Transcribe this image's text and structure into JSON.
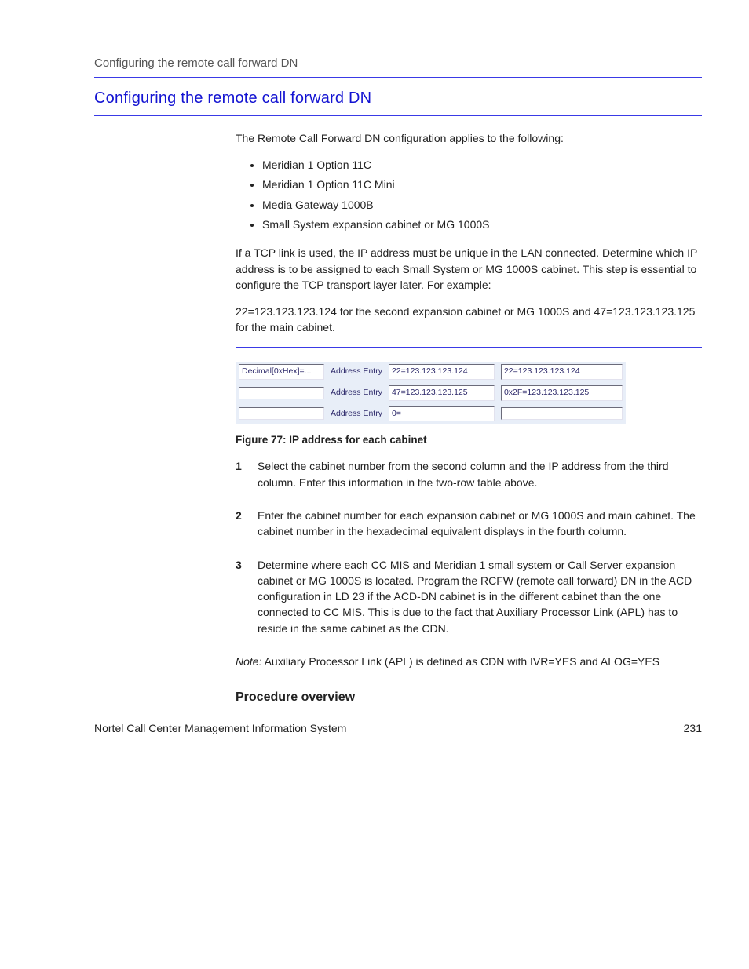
{
  "header": {
    "top_text": "Configuring the remote call forward DN"
  },
  "section": {
    "title": "Configuring the remote call forward DN"
  },
  "content": {
    "intro": "The Remote Call Forward DN configuration applies to the following:",
    "bullets": [
      "Meridian 1 Option 11C",
      "Meridian 1 Option 11C Mini",
      "Media Gateway 1000B",
      "Small System expansion cabinet or MG 1000S"
    ],
    "ip_intro": "If a TCP link is used, the IP address must be unique in the LAN connected. Determine which IP address is to be assigned to each Small System or MG 1000S cabinet. This step is essential to configure the TCP transport layer later. For example:",
    "ip_example": "22=123.123.123.124 for the second expansion cabinet or MG 1000S and 47=123.123.123.125 for the main cabinet.",
    "fig_table": {
      "rows": [
        {
          "c1": "Decimal[0xHex]=...",
          "c2": "Address Entry",
          "c3": "22=123.123.123.124",
          "c4": "22=123.123.123.124"
        },
        {
          "c1": "",
          "c2": "Address Entry",
          "c3": "47=123.123.123.125",
          "c4": "0x2F=123.123.123.125"
        },
        {
          "c1": "",
          "c2": "Address Entry",
          "c3": "0=",
          "c4": ""
        }
      ]
    },
    "fig_caption": "Figure 77: IP address for each cabinet",
    "steps": [
      "Select the cabinet number from the second column and the IP address from the third column. Enter this information in the two-row table above.",
      "Enter the cabinet number for each expansion cabinet or MG 1000S and main cabinet. The cabinet number in the hexadecimal equivalent displays in the fourth column.",
      "Determine where each CC MIS and Meridian 1 small system or Call Server expansion cabinet or MG 1000S is located. Program the RCFW (remote call forward) DN in the ACD configuration in LD 23 if the ACD-DN cabinet is in the different cabinet than the one connected to CC MIS. This is due to the fact that Auxiliary Processor Link (APL) has to reside in the same cabinet as the CDN."
    ],
    "note_lead": "Note:",
    "note_text": " Auxiliary Processor Link (APL) is defined as CDN with IVR=YES and ALOG=YES",
    "subhead": "Procedure overview"
  },
  "footer": {
    "left": "Nortel Call Center Management Information System",
    "right": "231"
  }
}
